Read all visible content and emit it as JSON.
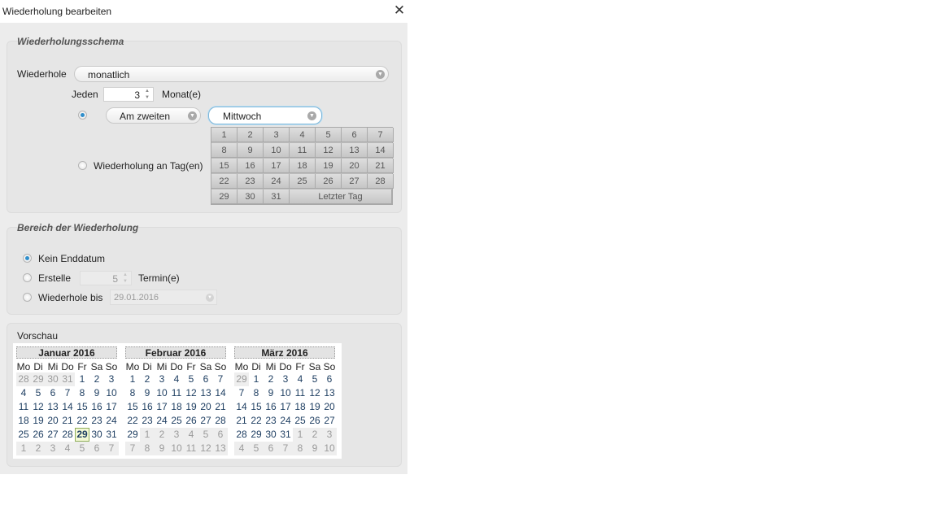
{
  "window": {
    "title": "Wiederholung bearbeiten",
    "close_icon": "close-icon"
  },
  "schema": {
    "legend": "Wiederholungsschema",
    "repeat_label": "Wiederhole",
    "repeat_value": "monatlich",
    "every_label": "Jeden",
    "every_value": "3",
    "unit_label": "Monat(e)",
    "ordinal_value": "Am zweiten",
    "weekday_value": "Mittwoch",
    "days_radio_label": "Wiederholung an Tag(en)",
    "day_grid": [
      "1",
      "2",
      "3",
      "4",
      "5",
      "6",
      "7",
      "8",
      "9",
      "10",
      "11",
      "12",
      "13",
      "14",
      "15",
      "16",
      "17",
      "18",
      "19",
      "20",
      "21",
      "22",
      "23",
      "24",
      "25",
      "26",
      "27",
      "28",
      "29",
      "30",
      "31"
    ],
    "last_day_label": "Letzter Tag"
  },
  "range": {
    "legend": "Bereich der Wiederholung",
    "no_end_label": "Kein Enddatum",
    "create_label": "Erstelle",
    "create_value": "5",
    "occurrences_label": "Termin(e)",
    "until_label": "Wiederhole bis",
    "until_value": "29.01.2016"
  },
  "preview": {
    "legend": "Vorschau",
    "weekdays": [
      "Mo",
      "Di",
      "Mi",
      "Do",
      "Fr",
      "Sa",
      "So"
    ],
    "months": [
      {
        "name": "Januar 2016",
        "days": [
          "28",
          "29",
          "30",
          "31",
          "1",
          "2",
          "3",
          "4",
          "5",
          "6",
          "7",
          "8",
          "9",
          "10",
          "11",
          "12",
          "13",
          "14",
          "15",
          "16",
          "17",
          "18",
          "19",
          "20",
          "21",
          "22",
          "23",
          "24",
          "25",
          "26",
          "27",
          "28",
          "29",
          "30",
          "31",
          "1",
          "2",
          "3",
          "4",
          "5",
          "6",
          "7"
        ],
        "first_current": 4,
        "last_current": 34,
        "today": 32
      },
      {
        "name": "Februar 2016",
        "days": [
          "1",
          "2",
          "3",
          "4",
          "5",
          "6",
          "7",
          "8",
          "9",
          "10",
          "11",
          "12",
          "13",
          "14",
          "15",
          "16",
          "17",
          "18",
          "19",
          "20",
          "21",
          "22",
          "23",
          "24",
          "25",
          "26",
          "27",
          "28",
          "29",
          "1",
          "2",
          "3",
          "4",
          "5",
          "6",
          "7",
          "8",
          "9",
          "10",
          "11",
          "12",
          "13"
        ],
        "first_current": 0,
        "last_current": 28,
        "today": -1
      },
      {
        "name": "März 2016",
        "days": [
          "29",
          "1",
          "2",
          "3",
          "4",
          "5",
          "6",
          "7",
          "8",
          "9",
          "10",
          "11",
          "12",
          "13",
          "14",
          "15",
          "16",
          "17",
          "18",
          "19",
          "20",
          "21",
          "22",
          "23",
          "24",
          "25",
          "26",
          "27",
          "28",
          "29",
          "30",
          "31",
          "1",
          "2",
          "3",
          "4",
          "5",
          "6",
          "7",
          "8",
          "9",
          "10"
        ],
        "first_current": 1,
        "last_current": 31,
        "today": -1
      }
    ]
  }
}
